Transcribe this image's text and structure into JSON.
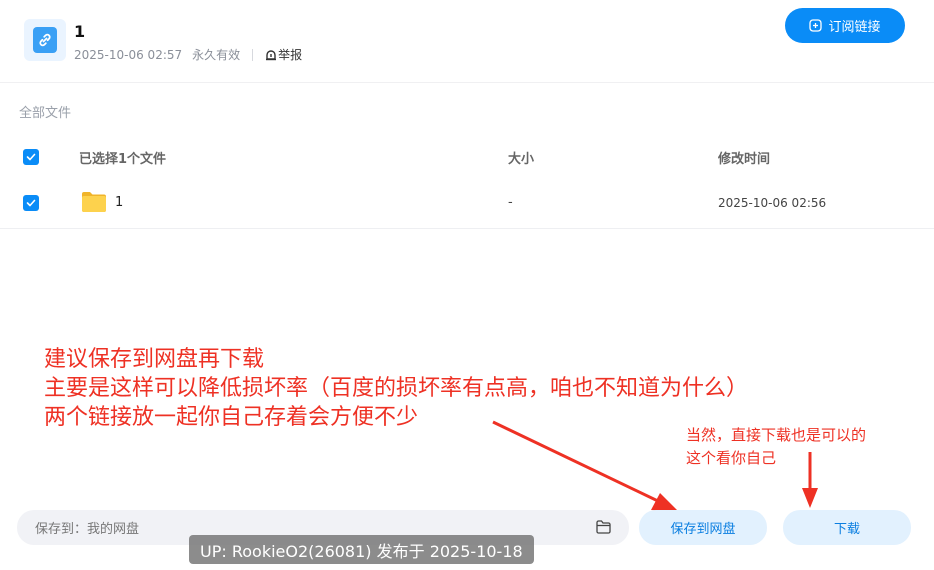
{
  "header": {
    "title": "1",
    "date": "2025-10-06 02:57",
    "validity": "永久有效",
    "report_label": "举报",
    "subscribe_label": "订阅链接",
    "share_icon": "link-icon"
  },
  "list": {
    "breadcrumb": "全部文件",
    "header": {
      "selected_label": "已选择1个文件",
      "size_label": "大小",
      "time_label": "修改时间",
      "checked": true
    },
    "rows": [
      {
        "name": "1",
        "size": "-",
        "modified": "2025-10-06 02:56",
        "type": "folder",
        "checked": true
      }
    ]
  },
  "annotations": {
    "main": [
      "建议保存到网盘再下载",
      "主要是这样可以降低损坏率（百度的损坏率有点高，咱也不知道为什么）",
      "两个链接放一起你自己存着会方便不少"
    ],
    "side": [
      "当然，直接下载也是可以的",
      "这个看你自己"
    ]
  },
  "bottom": {
    "save_path_label": "保存到：我的网盘",
    "save_button": "保存到网盘",
    "download_button": "下载"
  },
  "watermark": "UP: RookieO2(26081) 发布于 2025-10-18",
  "colors": {
    "accent": "#0a8cf7",
    "annotation": "#ee3124",
    "button_bg": "#e2f1fe",
    "folder": "#f7c23b"
  }
}
